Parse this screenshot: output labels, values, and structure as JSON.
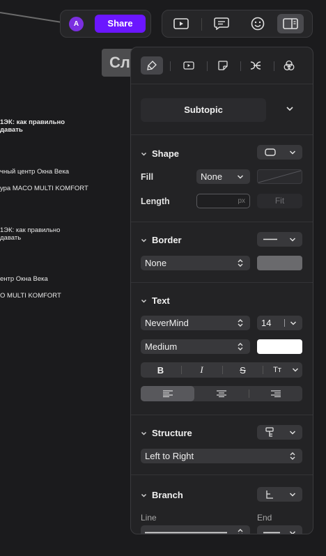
{
  "share": {
    "avatar_letter": "A",
    "button_label": "Share"
  },
  "toolbar": {
    "icons": [
      "play-icon",
      "comment-icon",
      "emoji-icon",
      "panel-icon"
    ],
    "active_index": 3
  },
  "canvas": {
    "node_title": "Сл",
    "lines": [
      "1ЭК: как правильно",
      "давать",
      "чный центр Окна Века",
      "ура MACO MULTI KOMFORT",
      "1ЭК: как правильно",
      "давать",
      "ентр Окна Века",
      "O MULTI KOMFORT"
    ]
  },
  "panel": {
    "tabs": [
      "brush-icon",
      "play-icon",
      "sticker-icon",
      "branch-icon",
      "palette-icon"
    ],
    "style_name": "Subtopic",
    "shape": {
      "title": "Shape",
      "fill_label": "Fill",
      "fill_value": "None",
      "length_label": "Length",
      "length_unit": "px",
      "fit_label": "Fit"
    },
    "border": {
      "title": "Border",
      "value": "None",
      "swatch_color": "#6a6a6d"
    },
    "text": {
      "title": "Text",
      "font": "NeverMind",
      "size": "14",
      "weight": "Medium",
      "color": "#ffffff",
      "format_buttons": [
        "B",
        "I",
        "S",
        "Tт"
      ]
    },
    "structure": {
      "title": "Structure",
      "value": "Left to Right"
    },
    "branch": {
      "title": "Branch",
      "line_label": "Line",
      "end_label": "End"
    }
  }
}
